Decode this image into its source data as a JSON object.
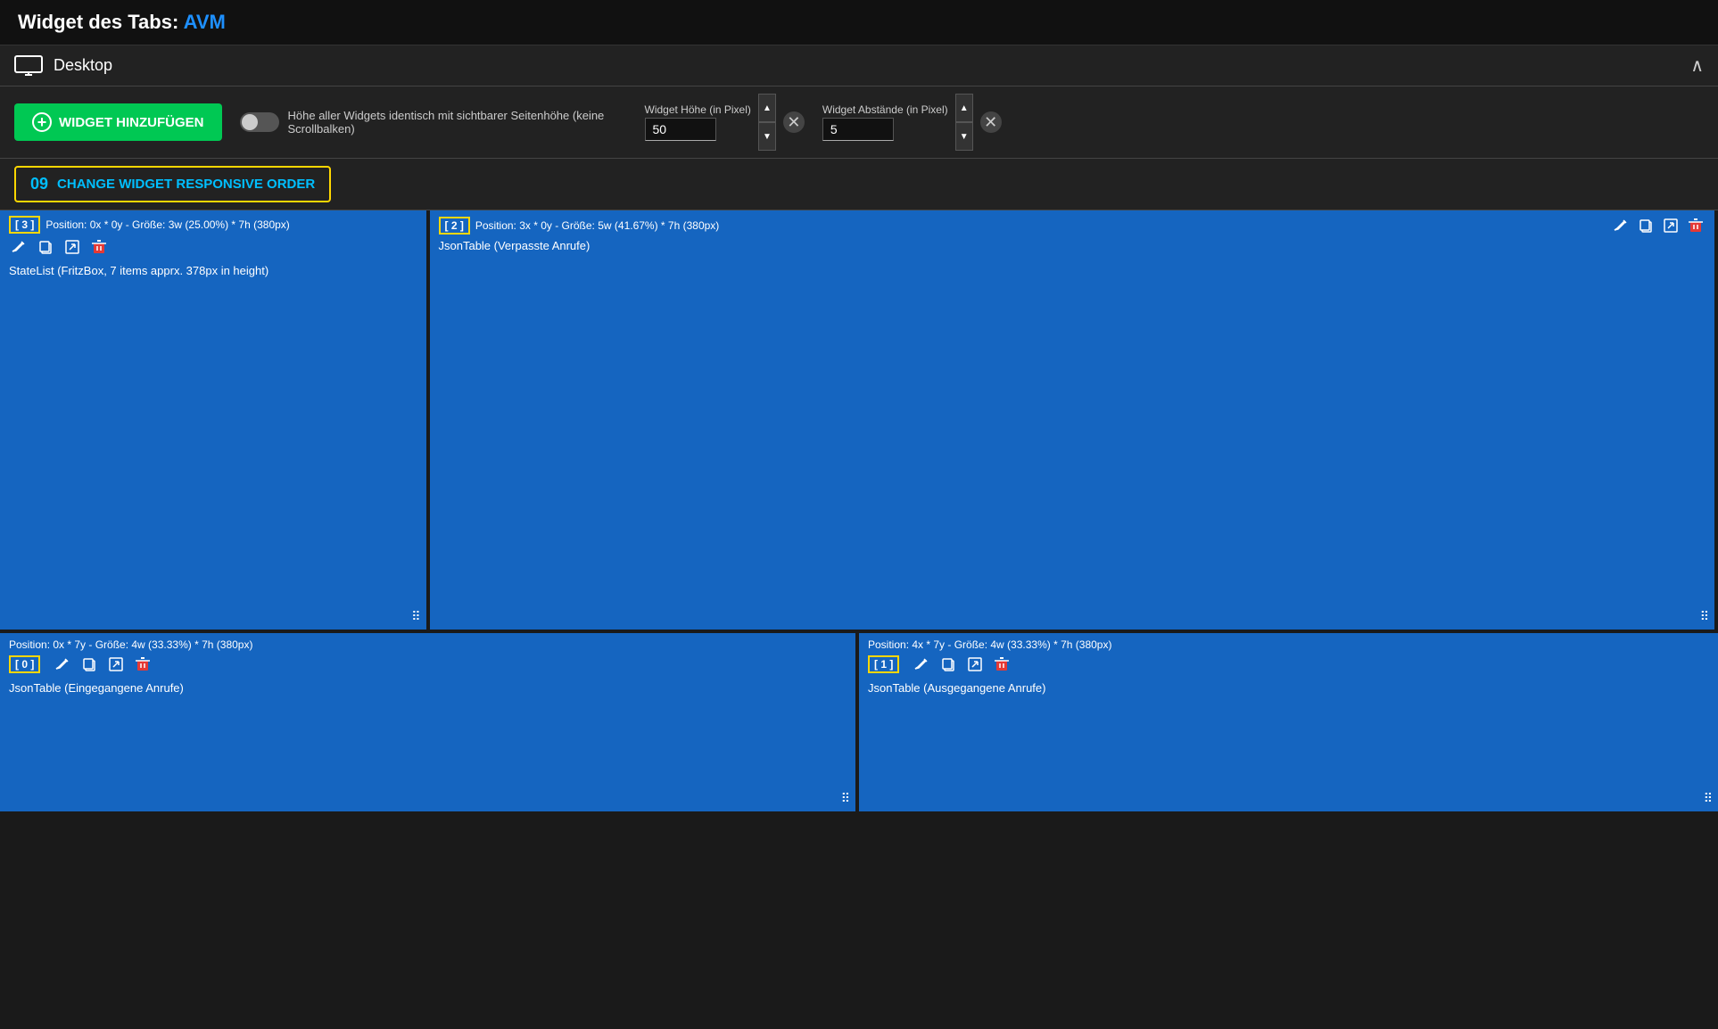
{
  "header": {
    "title_prefix": "Widget des Tabs:",
    "title_name": "AVM"
  },
  "toolbar": {
    "desktop_label": "Desktop",
    "chevron": "∧"
  },
  "controls": {
    "add_widget_label": "WIDGET HINZUFÜGEN",
    "toggle_label": "Höhe aller Widgets identisch mit sichtbarer Seitenhöhe (keine Scrollbalken)",
    "height_label": "Widget Höhe (in Pixel)",
    "height_value": "50",
    "spacing_label": "Widget Abstände (in Pixel)",
    "spacing_value": "5",
    "change_order_label": "CHANGE WIDGET RESPONSIVE ORDER",
    "change_order_icon": "09"
  },
  "widgets": [
    {
      "id": "widget-1",
      "order_badge": "[ 3 ]",
      "position_info": "Position: 0x * 0y - Größe: 3w (25.00%) * 7h (380px)",
      "title": "StateList (FritzBox, 7 items apprx. 378px in height)",
      "width_pct": 25,
      "row": 0
    },
    {
      "id": "widget-2",
      "order_badge": "[ 2 ]",
      "position_info": "Position: 3x * 0y - Größe: 5w (41.67%) * 7h (380px)",
      "title": "JsonTable (Verpasste Anrufe)",
      "width_pct": 41.67,
      "row": 0
    },
    {
      "id": "widget-3",
      "order_badge": "[ 0 ]",
      "position_info": "Position: 0x * 7y - Größe: 4w (33.33%) * 7h (380px)",
      "title": "JsonTable (Eingegangene Anrufe)",
      "width_pct": 50,
      "row": 1
    },
    {
      "id": "widget-4",
      "order_badge": "[ 1 ]",
      "position_info": "Position: 4x * 7y - Größe: 4w (33.33%) * 7h (380px)",
      "title": "JsonTable (Ausgegangene Anrufe)",
      "width_pct": 50,
      "row": 1
    }
  ],
  "icons": {
    "edit": "✏",
    "copy": "⧉",
    "export": "↗",
    "delete": "🗑",
    "resize": "⤡",
    "monitor": "🖥",
    "plus": "+"
  }
}
